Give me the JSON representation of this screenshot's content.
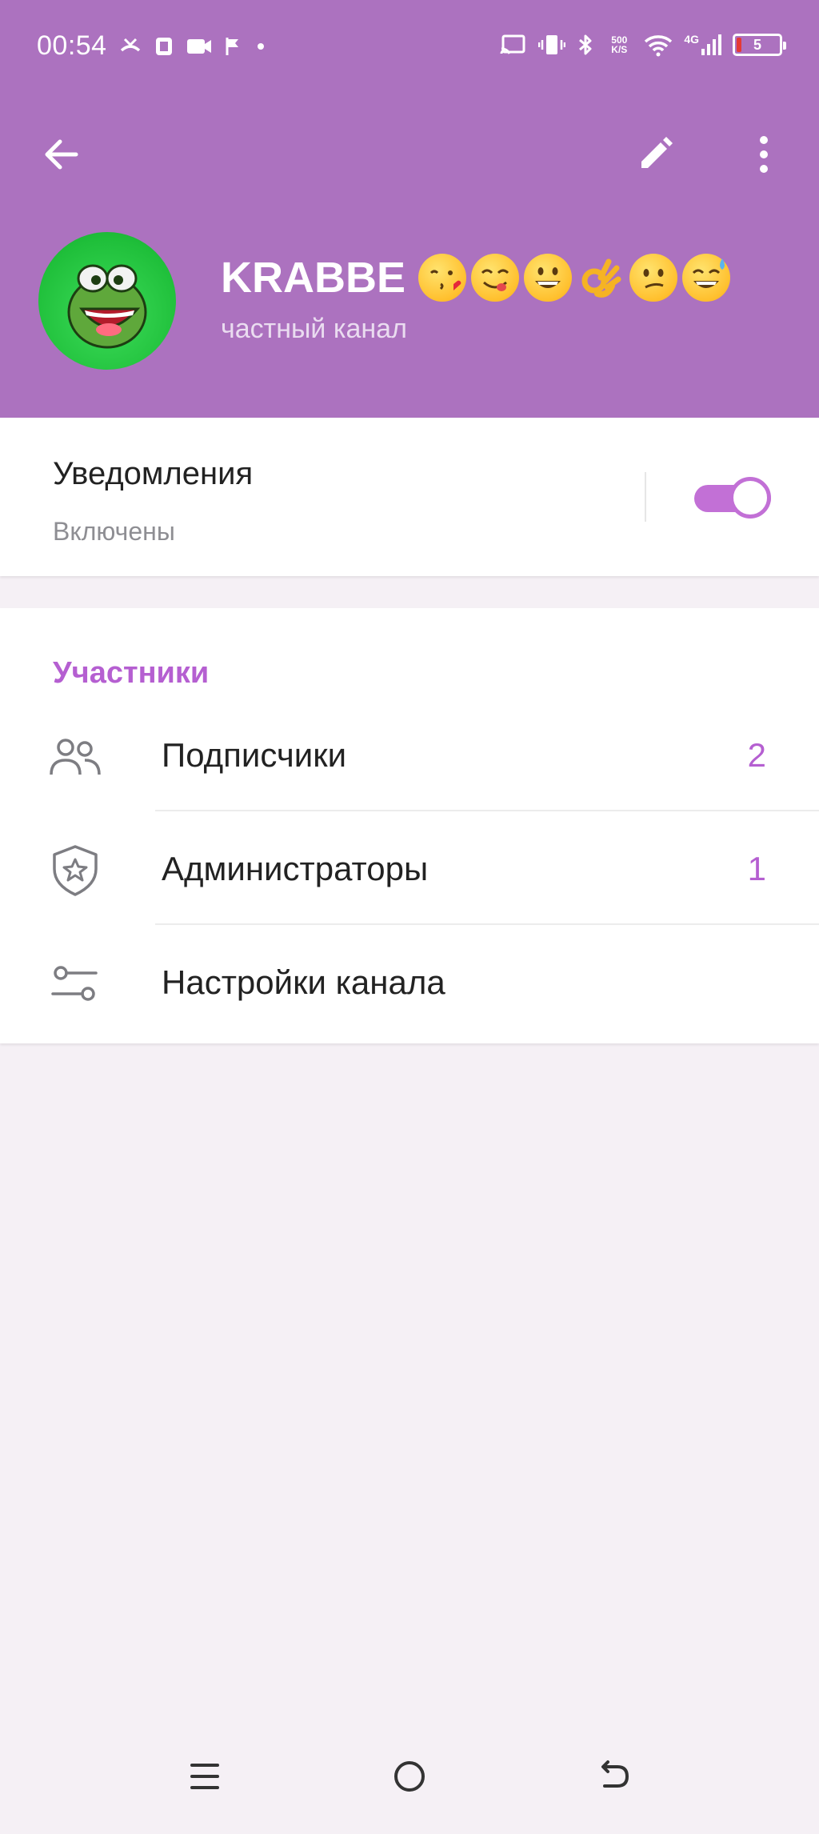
{
  "status_bar": {
    "time": "00:54",
    "net_speed_top": "500",
    "net_speed_bottom": "K/S",
    "network_type": "4G",
    "battery_level": "5"
  },
  "header": {
    "channel_name": "KRABBE",
    "subtitle": "частный канал",
    "background_color": "#ac72bf",
    "emojis": [
      "kissing-heart-emoji",
      "yum-emoji",
      "grinning-emoji",
      "ok-hand-emoji",
      "confused-emoji",
      "sweat-smile-emoji"
    ]
  },
  "notifications": {
    "title": "Уведомления",
    "status": "Включены",
    "enabled": true,
    "accent_color": "#c270d6"
  },
  "members": {
    "section_title": "Участники",
    "items": [
      {
        "label": "Подписчики",
        "value": "2",
        "icon": "people-icon"
      },
      {
        "label": "Администраторы",
        "value": "1",
        "icon": "shield-star-icon"
      },
      {
        "label": "Настройки канала",
        "value": "",
        "icon": "sliders-icon"
      }
    ]
  },
  "nav_bar": {
    "icons": [
      "menu-icon",
      "home-circle-icon",
      "back-return-icon"
    ]
  }
}
